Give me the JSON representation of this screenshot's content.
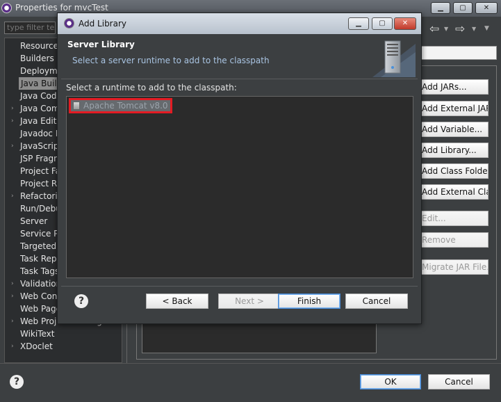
{
  "background_window": {
    "title": "Properties for mvcTest",
    "filter_placeholder": "type filter text",
    "tree_items": [
      "Resource",
      "Builders",
      "Deployment Assembly",
      "Java Build Path",
      "Java Code Style",
      "Java Compiler",
      "Java Editor",
      "Javadoc Location",
      "JavaScript",
      "JSP Fragment",
      "Project Facets",
      "Project References",
      "Refactoring History",
      "Run/Debug Settings",
      "Server",
      "Service Policies",
      "Targeted Runtimes",
      "Task Repository",
      "Task Tags",
      "Validation",
      "Web Content Settings",
      "Web Page Editor",
      "Web Project Settings",
      "WikiText",
      "XDoclet"
    ],
    "selected_index": 3,
    "side_buttons": [
      {
        "label": "Add JARs...",
        "disabled": false
      },
      {
        "label": "Add External JARs...",
        "disabled": false
      },
      {
        "label": "Add Variable...",
        "disabled": false
      },
      {
        "label": "Add Library...",
        "disabled": false
      },
      {
        "label": "Add Class Folder...",
        "disabled": false
      },
      {
        "label": "Add External Class Folder...",
        "disabled": false
      },
      {
        "label": "Edit...",
        "disabled": true
      },
      {
        "label": "Remove",
        "disabled": true
      },
      {
        "label": "Migrate JAR File...",
        "disabled": true
      }
    ],
    "ok_label": "OK",
    "cancel_label": "Cancel"
  },
  "dialog": {
    "title": "Add Library",
    "header_title": "Server Library",
    "header_description": "Select a server runtime to add to the classpath",
    "list_label": "Select a runtime to add to the classpath:",
    "runtimes": [
      "Apache Tomcat v8.0"
    ],
    "back_label": "< Back",
    "next_label": "Next >",
    "finish_label": "Finish",
    "cancel_label": "Cancel"
  },
  "colors": {
    "highlight_box": "#e31b23",
    "dark_bg": "#3c3f41",
    "default_button_border": "#4a8cd8"
  }
}
